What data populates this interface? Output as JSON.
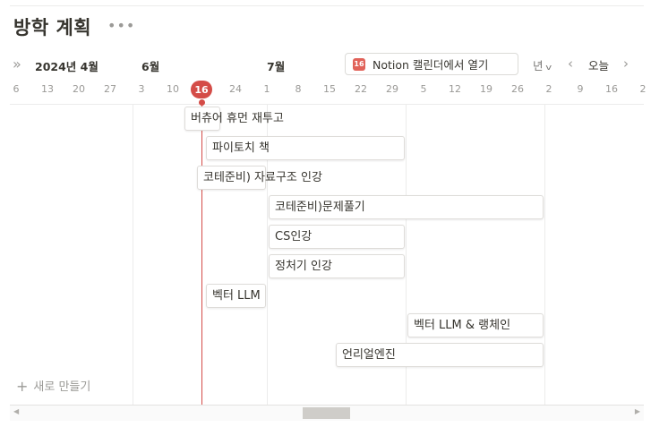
{
  "page": {
    "title": "방학 계획",
    "more_icon": "•••"
  },
  "toolbar": {
    "collapse_icon": "»",
    "months": [
      "2024년 4월",
      "6월",
      "7월"
    ],
    "notion_calendar_button": "Notion 캘린더에서 열기",
    "calendar_icon_day": "16",
    "range_select": "년",
    "prev_icon": "‹",
    "today_button": "오늘",
    "next_icon": "›"
  },
  "timeline": {
    "days": [
      "6",
      "13",
      "20",
      "27",
      "3",
      "10",
      "16",
      "24",
      "1",
      "8",
      "15",
      "22",
      "29",
      "5",
      "12",
      "19",
      "26",
      "2",
      "9",
      "16",
      "2"
    ],
    "today_label": "16"
  },
  "tasks": [
    {
      "name": "버츄어 휴먼 재투고"
    },
    {
      "name": "파이토치 책"
    },
    {
      "name": "코테준비) 자료구조 인강"
    },
    {
      "name": "코테준비)문제풀기"
    },
    {
      "name": "CS인강"
    },
    {
      "name": "정처기 인강"
    },
    {
      "name": "벡터 LLM"
    },
    {
      "name": "벡터 LLM & 랭체인"
    },
    {
      "name": "언리얼엔진"
    }
  ],
  "new_row": {
    "plus_icon": "+",
    "label": "새로 만들기"
  },
  "scrollbar": {
    "left_icon": "◀",
    "right_icon": "▶"
  },
  "colors": {
    "today_accent": "#d44c47",
    "calendar_icon": "#e16259"
  }
}
